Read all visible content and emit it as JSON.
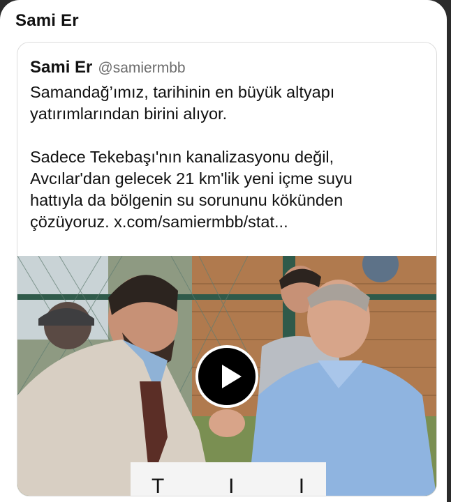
{
  "sheet": {
    "title": "Sami Er"
  },
  "post": {
    "author_name": "Sami Er",
    "author_handle": "@samiermbb",
    "text": "Samandağ’ımız, tarihinin en büyük altyapı\nyatırımlarından birini alıyor.\n\nSadece Tekebaşı'nın kanalizasyonu değil,\nAvcılar'dan gelecek 21 km'lik yeni içme suyu\nhattıyla da bölgenin su sorununu kökünden\nçözüyoruz. ",
    "link_text": "x.com/samiermbb/stat..."
  },
  "media": {
    "type": "video",
    "play_icon": "play-icon",
    "caption_partial": "T I I"
  }
}
